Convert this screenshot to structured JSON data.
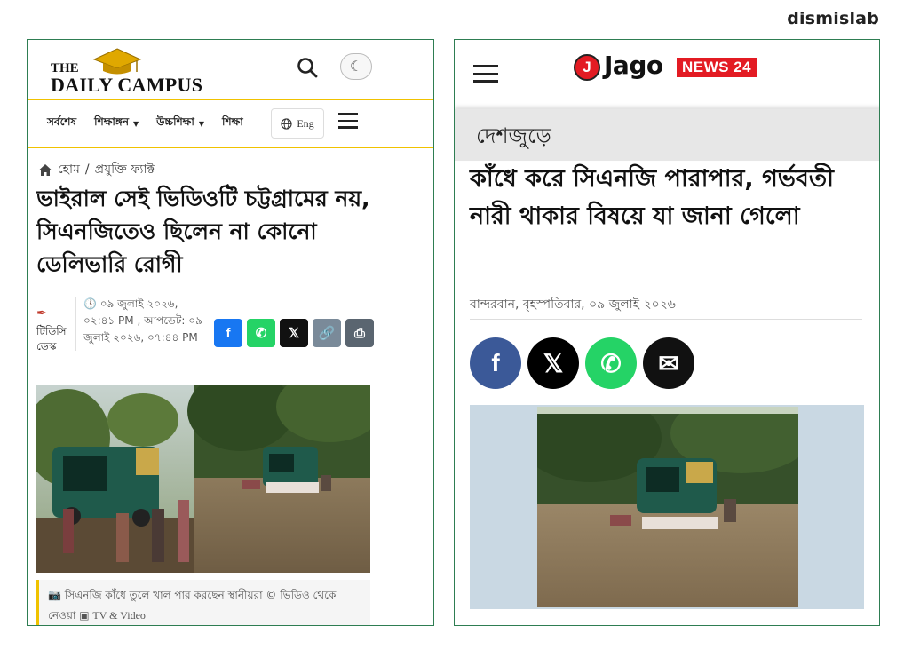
{
  "watermark": "dismislab",
  "left": {
    "logo": {
      "the": "THE",
      "name": "DAILY CAMPUS"
    },
    "header_icons": [
      "search-icon",
      "moon-icon"
    ],
    "nav": {
      "items": [
        {
          "label": "সর্বশেষ",
          "has_dropdown": false
        },
        {
          "label": "শিক্ষাঙ্গন",
          "has_dropdown": true
        },
        {
          "label": "উচ্চশিক্ষা",
          "has_dropdown": true
        },
        {
          "label": "শিক্ষা",
          "has_dropdown": false
        }
      ],
      "lang_label": "Eng"
    },
    "breadcrumb": {
      "home": "হোম",
      "separator": "/",
      "section": "প্রযুক্তি ফ্যাক্ট"
    },
    "headline": "ভাইরাল সেই ভিডিওটি চট্টগ্রামের নয়, সিএনজিতেও ছিলেন না কোনো ডেলিভারি রোগী",
    "author": "টিডিসি ডেস্ক",
    "date": "০৯ জুলাই ২০২৬, ০২:৪১ PM , আপডেট: ০৯ জুলাই ২০২৬, ০৭:৪৪ PM",
    "share_buttons": [
      {
        "name": "facebook",
        "glyph": "f",
        "color": "#1877f2"
      },
      {
        "name": "whatsapp",
        "glyph": "✆",
        "color": "#25d366"
      },
      {
        "name": "x",
        "glyph": "𝕏",
        "color": "#111111"
      },
      {
        "name": "copy-link",
        "glyph": "🔗",
        "color": "#7a8a99"
      },
      {
        "name": "print",
        "glyph": "⎙",
        "color": "#5a6570"
      }
    ],
    "caption": {
      "text": "সিএনজি কাঁধে তুলে খাল পার করছেন স্থানীয়রা © ভিডিও থেকে নেওয়া",
      "source": "TV & Video"
    }
  },
  "right": {
    "logo": {
      "mark": "J",
      "jago": "Jago",
      "news": "NEWS 24"
    },
    "category": "দেশজুড়ে",
    "headline": "কাঁধে করে সিএনজি পারাপার, গর্ভবতী নারী থাকার বিষয়ে যা জানা গেলো",
    "meta": "বান্দরবান, বৃহস্পতিবার, ০৯ জুলাই ২০২৬",
    "share_buttons": [
      {
        "name": "facebook",
        "glyph": "f",
        "color": "#3b5998"
      },
      {
        "name": "x",
        "glyph": "𝕏",
        "color": "#000000"
      },
      {
        "name": "whatsapp",
        "glyph": "✆",
        "color": "#25d366"
      },
      {
        "name": "email",
        "glyph": "✉",
        "color": "#111111"
      }
    ]
  }
}
